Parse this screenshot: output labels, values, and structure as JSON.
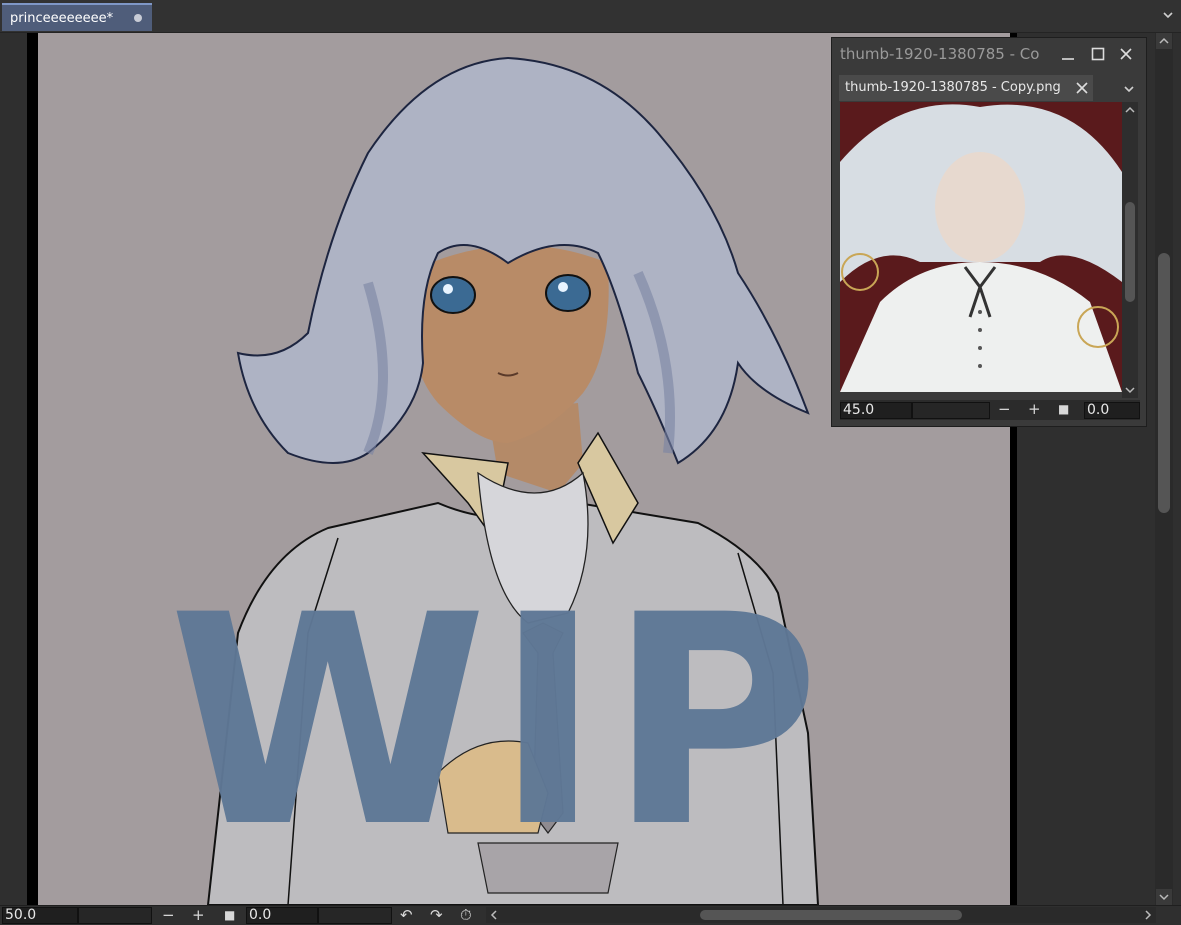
{
  "tabs": [
    {
      "label": "princeeeeeeee*"
    }
  ],
  "canvas": {
    "watermark_text": "WIP"
  },
  "reference_docker": {
    "window_title": "thumb-1920-1380785 - Co",
    "tab_label": "thumb-1920-1380785 - Copy.png",
    "zoom_value": "45.0",
    "rotation_value": "0.0"
  },
  "bottom_bar": {
    "zoom_value": "50.0",
    "rotation_value": "0.0"
  },
  "colors": {
    "canvas_background": "#a39c9e",
    "watermark": "#5f7896",
    "active_tab": "#4f5d7a"
  }
}
